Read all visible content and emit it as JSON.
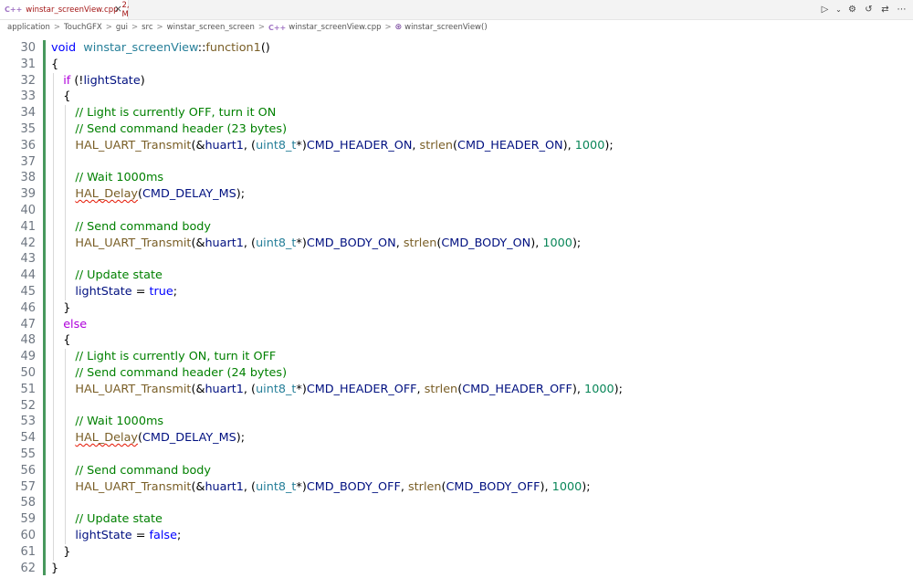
{
  "tab": {
    "icon": "C++",
    "filename": "winstar_screenView.cpp",
    "badge": "2, M",
    "close": "×"
  },
  "actions": [
    "run-icon",
    "chevron-down-icon",
    "settings-icon",
    "history-icon",
    "compare-icon",
    "more-icon"
  ],
  "breadcrumb": {
    "items": [
      "application",
      "TouchGFX",
      "gui",
      "src",
      "winstar_screen_screen",
      "winstar_screenView.cpp",
      "winstar_screenView()"
    ],
    "separator": ">"
  },
  "colors": {
    "keyword": "#0000ff",
    "control": "#af00db",
    "function": "#795e26",
    "type": "#267f99",
    "variable": "#001080",
    "number": "#098658",
    "comment": "#008000",
    "modified_gutter": "#48985d"
  },
  "code": {
    "lines": [
      {
        "n": "30",
        "t": [
          [
            "kw",
            "void"
          ],
          [
            "",
            "  "
          ],
          [
            "ty",
            "winstar_screenView"
          ],
          [
            "",
            "::"
          ],
          [
            "fn",
            "function1"
          ],
          [
            "",
            "()"
          ]
        ],
        "i": 0
      },
      {
        "n": "31",
        "t": [
          [
            "",
            "{"
          ]
        ],
        "i": 0
      },
      {
        "n": "32",
        "t": [
          [
            "ctl",
            "if"
          ],
          [
            "",
            " (!"
          ],
          [
            "var",
            "lightState"
          ],
          [
            "",
            ")"
          ]
        ],
        "i": 1
      },
      {
        "n": "33",
        "t": [
          [
            "",
            "{"
          ]
        ],
        "i": 1
      },
      {
        "n": "34",
        "t": [
          [
            "cm",
            "// Light is currently OFF, turn it ON"
          ]
        ],
        "i": 2
      },
      {
        "n": "35",
        "t": [
          [
            "cm",
            "// Send command header (23 bytes)"
          ]
        ],
        "i": 2
      },
      {
        "n": "36",
        "t": [
          [
            "fn",
            "HAL_UART_Transmit"
          ],
          [
            "",
            "(&"
          ],
          [
            "var",
            "huart1"
          ],
          [
            "",
            ", ("
          ],
          [
            "ty",
            "uint8_t"
          ],
          [
            "",
            "*)"
          ],
          [
            "var",
            "CMD_HEADER_ON"
          ],
          [
            "",
            ", "
          ],
          [
            "fn",
            "strlen"
          ],
          [
            "",
            "("
          ],
          [
            "var",
            "CMD_HEADER_ON"
          ],
          [
            "",
            "), "
          ],
          [
            "num",
            "1000"
          ],
          [
            "",
            ");"
          ]
        ],
        "i": 2
      },
      {
        "n": "37",
        "t": [],
        "i": 2
      },
      {
        "n": "38",
        "t": [
          [
            "cm",
            "// Wait 1000ms"
          ]
        ],
        "i": 2
      },
      {
        "n": "39",
        "t": [
          [
            "fn sq",
            "HAL_Delay"
          ],
          [
            "",
            "("
          ],
          [
            "var",
            "CMD_DELAY_MS"
          ],
          [
            "",
            ");"
          ]
        ],
        "i": 2
      },
      {
        "n": "40",
        "t": [],
        "i": 2
      },
      {
        "n": "41",
        "t": [
          [
            "cm",
            "// Send command body"
          ]
        ],
        "i": 2
      },
      {
        "n": "42",
        "t": [
          [
            "fn",
            "HAL_UART_Transmit"
          ],
          [
            "",
            "(&"
          ],
          [
            "var",
            "huart1"
          ],
          [
            "",
            ", ("
          ],
          [
            "ty",
            "uint8_t"
          ],
          [
            "",
            "*)"
          ],
          [
            "var",
            "CMD_BODY_ON"
          ],
          [
            "",
            ", "
          ],
          [
            "fn",
            "strlen"
          ],
          [
            "",
            "("
          ],
          [
            "var",
            "CMD_BODY_ON"
          ],
          [
            "",
            "), "
          ],
          [
            "num",
            "1000"
          ],
          [
            "",
            ");"
          ]
        ],
        "i": 2
      },
      {
        "n": "43",
        "t": [],
        "i": 2
      },
      {
        "n": "44",
        "t": [
          [
            "cm",
            "// Update state"
          ]
        ],
        "i": 2
      },
      {
        "n": "45",
        "t": [
          [
            "var",
            "lightState"
          ],
          [
            "",
            " = "
          ],
          [
            "kw",
            "true"
          ],
          [
            "",
            ";"
          ]
        ],
        "i": 2
      },
      {
        "n": "46",
        "t": [
          [
            "",
            "}"
          ]
        ],
        "i": 1
      },
      {
        "n": "47",
        "t": [
          [
            "ctl",
            "else"
          ]
        ],
        "i": 1
      },
      {
        "n": "48",
        "t": [
          [
            "",
            "{"
          ]
        ],
        "i": 1
      },
      {
        "n": "49",
        "t": [
          [
            "cm",
            "// Light is currently ON, turn it OFF"
          ]
        ],
        "i": 2
      },
      {
        "n": "50",
        "t": [
          [
            "cm",
            "// Send command header (24 bytes)"
          ]
        ],
        "i": 2
      },
      {
        "n": "51",
        "t": [
          [
            "fn",
            "HAL_UART_Transmit"
          ],
          [
            "",
            "(&"
          ],
          [
            "var",
            "huart1"
          ],
          [
            "",
            ", ("
          ],
          [
            "ty",
            "uint8_t"
          ],
          [
            "",
            "*)"
          ],
          [
            "var",
            "CMD_HEADER_OFF"
          ],
          [
            "",
            ", "
          ],
          [
            "fn",
            "strlen"
          ],
          [
            "",
            "("
          ],
          [
            "var",
            "CMD_HEADER_OFF"
          ],
          [
            "",
            "), "
          ],
          [
            "num",
            "1000"
          ],
          [
            "",
            ");"
          ]
        ],
        "i": 2
      },
      {
        "n": "52",
        "t": [],
        "i": 2
      },
      {
        "n": "53",
        "t": [
          [
            "cm",
            "// Wait 1000ms"
          ]
        ],
        "i": 2
      },
      {
        "n": "54",
        "t": [
          [
            "fn sq",
            "HAL_Delay"
          ],
          [
            "",
            "("
          ],
          [
            "var",
            "CMD_DELAY_MS"
          ],
          [
            "",
            ");"
          ]
        ],
        "i": 2
      },
      {
        "n": "55",
        "t": [],
        "i": 2
      },
      {
        "n": "56",
        "t": [
          [
            "cm",
            "// Send command body"
          ]
        ],
        "i": 2
      },
      {
        "n": "57",
        "t": [
          [
            "fn",
            "HAL_UART_Transmit"
          ],
          [
            "",
            "(&"
          ],
          [
            "var",
            "huart1"
          ],
          [
            "",
            ", ("
          ],
          [
            "ty",
            "uint8_t"
          ],
          [
            "",
            "*)"
          ],
          [
            "var",
            "CMD_BODY_OFF"
          ],
          [
            "",
            ", "
          ],
          [
            "fn",
            "strlen"
          ],
          [
            "",
            "("
          ],
          [
            "var",
            "CMD_BODY_OFF"
          ],
          [
            "",
            "), "
          ],
          [
            "num",
            "1000"
          ],
          [
            "",
            ");"
          ]
        ],
        "i": 2
      },
      {
        "n": "58",
        "t": [],
        "i": 2
      },
      {
        "n": "59",
        "t": [
          [
            "cm",
            "// Update state"
          ]
        ],
        "i": 2
      },
      {
        "n": "60",
        "t": [
          [
            "var",
            "lightState"
          ],
          [
            "",
            " = "
          ],
          [
            "kw",
            "false"
          ],
          [
            "",
            ";"
          ]
        ],
        "i": 2
      },
      {
        "n": "61",
        "t": [
          [
            "",
            "}"
          ]
        ],
        "i": 1
      },
      {
        "n": "62",
        "t": [
          [
            "",
            "}"
          ]
        ],
        "i": 0
      }
    ]
  }
}
